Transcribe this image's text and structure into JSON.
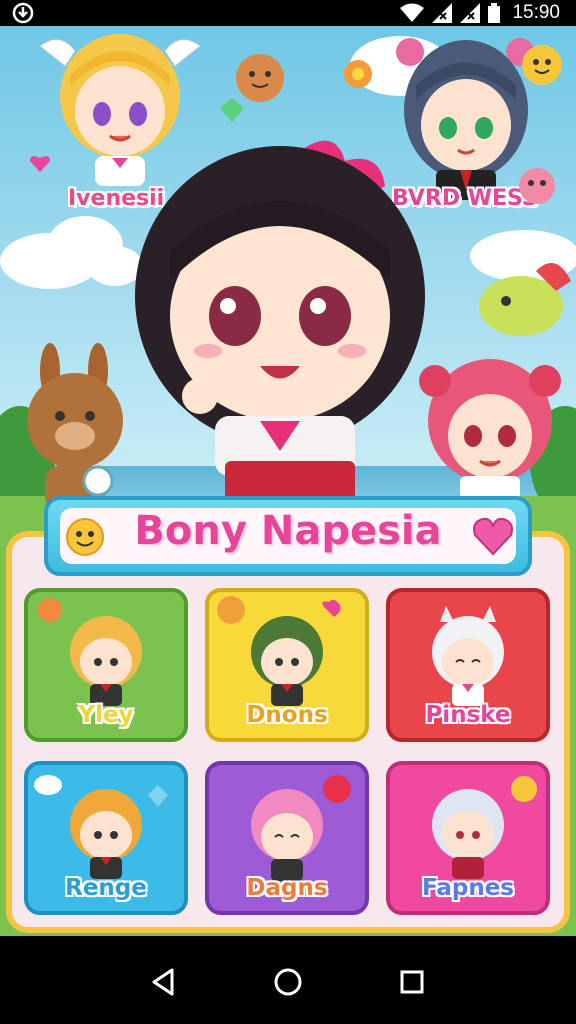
{
  "status_bar": {
    "time": "15:90",
    "left_icon": "app-notification-icon",
    "icons": [
      "wifi-icon",
      "signal-icon",
      "signal-icon-2",
      "battery-icon"
    ]
  },
  "hero": {
    "top_left_name": "Ivenesii",
    "top_right_name": "BVRD WESS"
  },
  "title": {
    "text": "Bony Napesia",
    "left_icon": "smiley-sun-icon",
    "right_icon": "heart-icon"
  },
  "tiles": [
    {
      "label": "Yley",
      "color": "#7cc24f"
    },
    {
      "label": "Dnons",
      "color": "#f7d93a"
    },
    {
      "label": "Pinske",
      "color": "#e8464b"
    },
    {
      "label": "Renge",
      "color": "#3cbbe8"
    },
    {
      "label": "Dagns",
      "color": "#9e5bd6"
    },
    {
      "label": "Fapnes",
      "color": "#ef4aa0"
    }
  ],
  "nav": {
    "back_icon": "back-triangle-icon",
    "home_icon": "home-circle-icon",
    "recents_icon": "recents-square-icon"
  }
}
